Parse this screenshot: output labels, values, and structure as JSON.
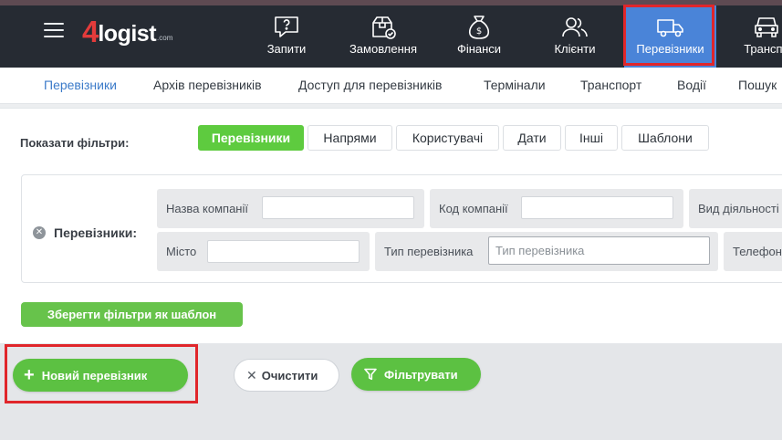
{
  "navbar": {
    "logo": {
      "four": "4",
      "word": "logist",
      "domain": ".com"
    },
    "items": [
      {
        "label": "Запити",
        "icon": "chat-question-icon"
      },
      {
        "label": "Замовлення",
        "icon": "package-check-icon"
      },
      {
        "label": "Фінанси",
        "icon": "money-bag-icon"
      },
      {
        "label": "Клієнти",
        "icon": "users-icon"
      },
      {
        "label": "Перевізники",
        "icon": "truck-icon",
        "active": true
      },
      {
        "label": "Транспо",
        "icon": "car-icon"
      }
    ],
    "active_color": "#4a84d8"
  },
  "subnav": {
    "items": [
      {
        "label": "Перевізники",
        "active": true
      },
      {
        "label": "Архів перевізників"
      },
      {
        "label": "Доступ для перевізників"
      },
      {
        "label": "Термінали"
      },
      {
        "label": "Транспорт"
      },
      {
        "label": "Водії"
      },
      {
        "label": "Пошук"
      }
    ]
  },
  "filters": {
    "label": "Показати фільтри:",
    "tabs": [
      {
        "label": "Перевізники",
        "active": true
      },
      {
        "label": "Напрями"
      },
      {
        "label": "Користувачі"
      },
      {
        "label": "Дати"
      },
      {
        "label": "Інші"
      },
      {
        "label": "Шаблони"
      }
    ],
    "group_title": "Перевізники:",
    "fields": [
      {
        "label": "Назва компанії",
        "value": ""
      },
      {
        "label": "Код компанії",
        "value": ""
      },
      {
        "label": "Вид діяльності"
      },
      {
        "label": "Місто",
        "value": ""
      },
      {
        "label": "Тип перевізника",
        "placeholder": "Тип перевізника"
      },
      {
        "label": "Телефон"
      }
    ],
    "save_template": "Зберегти фільтри як шаблон"
  },
  "actions": {
    "new_carrier": "Новий перевізник",
    "clear": "Очистити",
    "filter": "Фільтрувати"
  },
  "colors": {
    "green": "#5cc142",
    "highlight": "#e0262b"
  }
}
